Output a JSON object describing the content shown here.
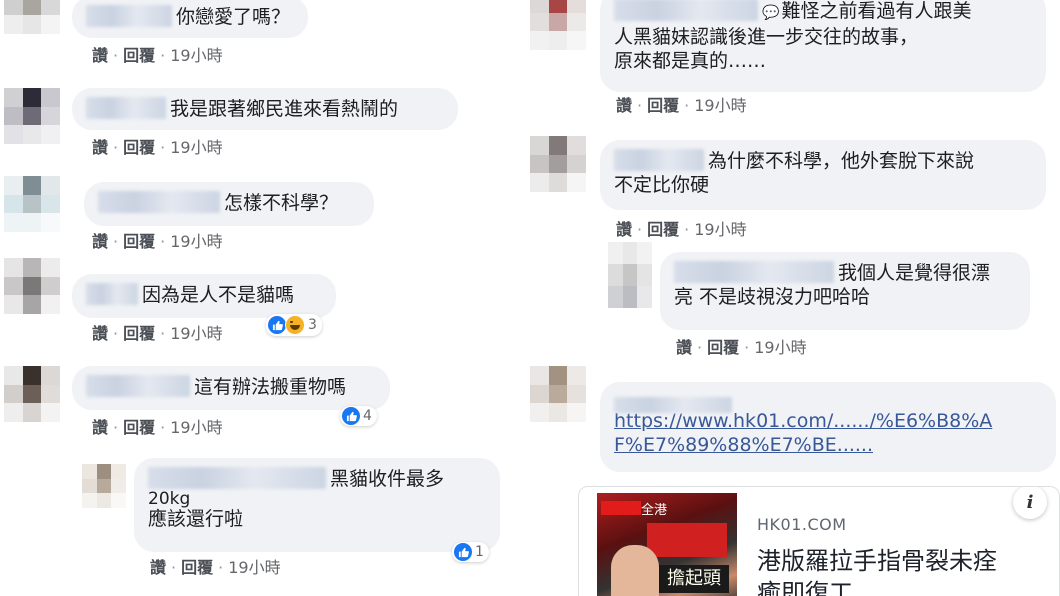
{
  "actions": {
    "like": "讚",
    "reply": "回覆",
    "sep": "·"
  },
  "left": [
    {
      "text": "你戀愛了嗎？",
      "time": "19小時"
    },
    {
      "text": "我是跟著鄉民進來看熱鬧的",
      "time": "19小時"
    },
    {
      "text": "怎樣不科學？",
      "time": "19小時"
    },
    {
      "text": "因為是人不是貓嗎",
      "time": "19小時",
      "reaction_count": "3"
    },
    {
      "text": "這有辦法搬重物嗎",
      "time": "19小時",
      "reaction_count": "4"
    },
    {
      "text_line1": "黑貓收件最多",
      "text_line2": "20kg",
      "text_line3": "應該還行啦",
      "time": "19小時",
      "reaction_count": "1"
    }
  ],
  "right": [
    {
      "text_line1": "難怪之前看過有人跟美",
      "text_line2": "人黑貓妹認識後進一步交往的故事，",
      "text_line3": "原來都是真的……",
      "time": "19小時"
    },
    {
      "text_line1": "為什麼不科學，他外套脫下來說",
      "text_line2": "不定比你硬",
      "time": "19小時"
    },
    {
      "text_line1": "我個人是覺得很漂",
      "text_line2": "亮 不是歧視沒力吧哈哈",
      "time": "19小時"
    },
    {
      "link_line1": "https://www.hk01.com/....../%E6%B8%A",
      "link_line2": "F%E7%89%88%E7%BE......",
      "preview": {
        "domain": "HK01.COM",
        "title": "港版羅拉手指骨裂未痊癒即復工",
        "image_text": "擔起頭",
        "image_label": "全港",
        "info_icon": "i"
      }
    }
  ],
  "colors": {
    "bubble": "#f0f2f5",
    "like_blue": "#1877f2",
    "link": "#385898"
  }
}
